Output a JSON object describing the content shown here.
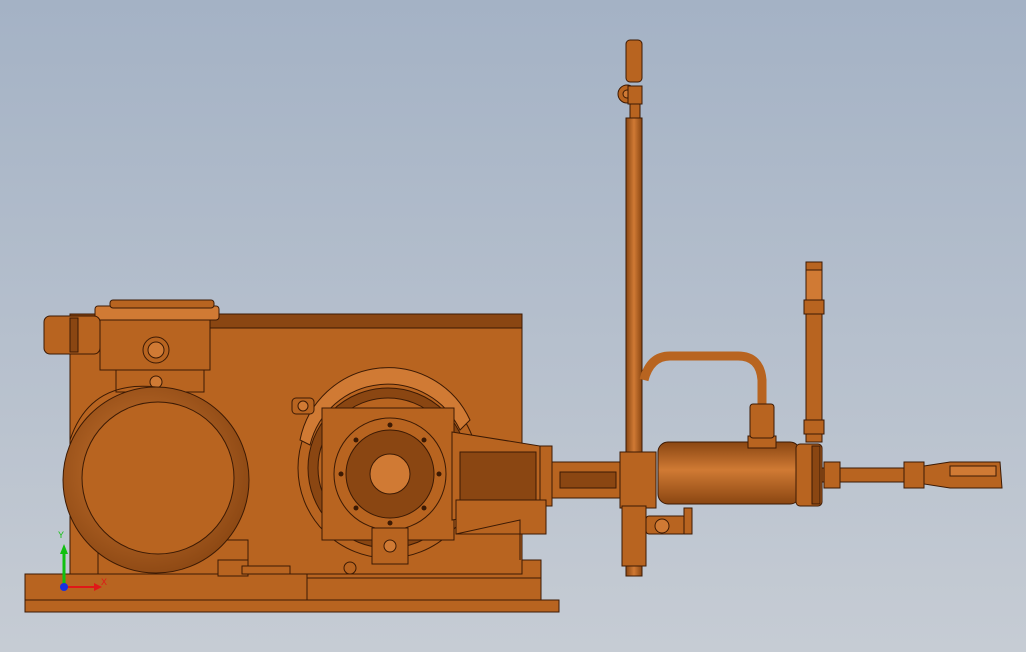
{
  "viewport": {
    "background_top": "#a4b2c5",
    "background_bottom": "#c6ccd4"
  },
  "model": {
    "body_color": "#b86420",
    "shade_color": "#8a4612",
    "highlight_color": "#d07a34",
    "edge_color": "#3c1a04"
  },
  "triad": {
    "x_axis_label": "X",
    "y_axis_label": "Y",
    "x_color": "#e01818",
    "y_color": "#10c010",
    "z_color": "#1830e0"
  }
}
